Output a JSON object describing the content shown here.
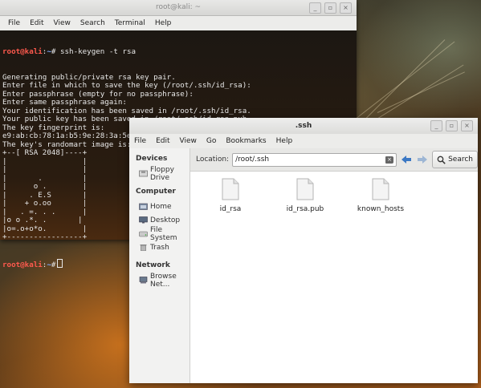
{
  "terminal": {
    "title": "root@kali: ~",
    "menu": [
      "File",
      "Edit",
      "View",
      "Search",
      "Terminal",
      "Help"
    ],
    "prompt_user": "root@kali",
    "prompt_path": "~",
    "command": "ssh-keygen -t rsa",
    "output_lines": [
      "Generating public/private rsa key pair.",
      "Enter file in which to save the key (/root/.ssh/id_rsa):",
      "Enter passphrase (empty for no passphrase):",
      "Enter same passphrase again:",
      "Your identification has been saved in /root/.ssh/id_rsa.",
      "Your public key has been saved in /root/.ssh/id_rsa.pub.",
      "The key fingerprint is:",
      "e9:ab:cb:78:1a:b5:9e:28:3a:5e:9c:e8:1f:74:47:3a root@kali",
      "The key's randomart image is:",
      "+--[ RSA 2048]----+",
      "|                 |",
      "|                 |",
      "|       .         |",
      "|      o .        |",
      "|     . E.S       |",
      "|    + o.oo       |",
      "|   . =. . .      |",
      "|o o .*. .       |",
      "|o=.o+o*o.        |",
      "+-----------------+"
    ]
  },
  "filemanager": {
    "title": ".ssh",
    "menu": [
      "File",
      "Edit",
      "View",
      "Go",
      "Bookmarks",
      "Help"
    ],
    "sidebar": {
      "devices_heading": "Devices",
      "devices": [
        {
          "label": "Floppy Drive",
          "icon": "floppy-icon"
        }
      ],
      "computer_heading": "Computer",
      "computer": [
        {
          "label": "Home",
          "icon": "home-icon"
        },
        {
          "label": "Desktop",
          "icon": "desktop-icon"
        },
        {
          "label": "File System",
          "icon": "drive-icon"
        },
        {
          "label": "Trash",
          "icon": "trash-icon"
        }
      ],
      "network_heading": "Network",
      "network": [
        {
          "label": "Browse Net...",
          "icon": "network-icon"
        }
      ]
    },
    "location_label": "Location:",
    "location_value": "/root/.ssh",
    "search_label": "Search",
    "files": [
      {
        "name": "id_rsa"
      },
      {
        "name": "id_rsa.pub"
      },
      {
        "name": "known_hosts"
      }
    ]
  },
  "colors": {
    "prompt": "#ff5a4e",
    "path": "#7aa8ff",
    "nav_arrow": "#3b78c4"
  }
}
